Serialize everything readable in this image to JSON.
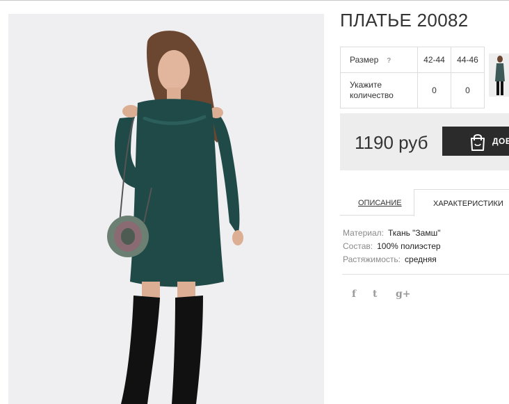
{
  "product": {
    "title": "ПЛАТЬЕ 20082",
    "price": "1190 руб"
  },
  "size_table": {
    "size_label": "Размер",
    "help": "?",
    "sizes": [
      "42-44",
      "44-46"
    ],
    "quantity_label": "Укажите количество",
    "quantities": [
      "0",
      "0"
    ]
  },
  "cart": {
    "button_label": "ДОБ"
  },
  "tabs": {
    "description": "ОПИСАНИЕ",
    "characteristics": "ХАРАКТЕРИСТИКИ",
    "active": "characteristics"
  },
  "properties": [
    {
      "label": "Материал:",
      "value": "Ткань \"Замш\""
    },
    {
      "label": "Состав:",
      "value": "100% полиэстер"
    },
    {
      "label": "Растяжимость:",
      "value": "средняя"
    }
  ],
  "social": {
    "facebook": "f",
    "twitter": "t",
    "google_plus": "g+"
  },
  "colors": {
    "dress": "#1f4a48",
    "button": "#2b2b2b",
    "price_box": "#ededed",
    "photo_bg": "#efeef0"
  }
}
